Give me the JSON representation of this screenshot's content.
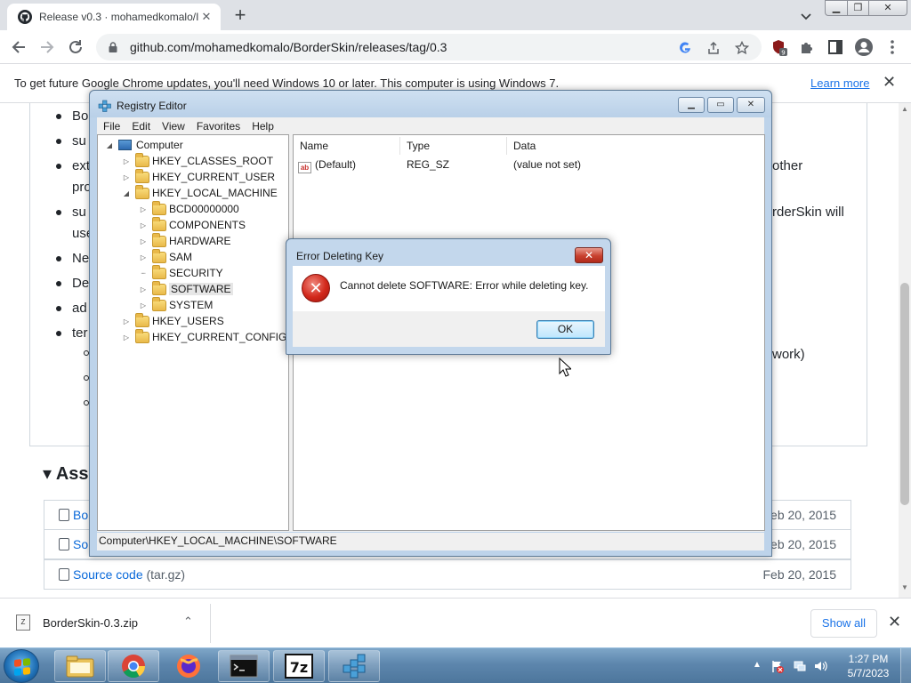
{
  "browser": {
    "tab_title": "Release v0.3 · mohamedkomalo/I",
    "new_tab": "+",
    "url": "github.com/mohamedkomalo/BorderSkin/releases/tag/0.3",
    "extension_badge": "9"
  },
  "infobar": {
    "message": "To get future Google Chrome updates, you'll need Windows 10 or later. This computer is using Windows 7.",
    "link": "Learn more"
  },
  "page": {
    "bullets": [
      "Bo",
      "su",
      "ext",
      "pro",
      "su",
      "use",
      "Ne",
      "De",
      "ad",
      "ter"
    ],
    "right_fragments": [
      "other",
      "rderSkin will",
      "work)"
    ],
    "assets_title": "Asse",
    "assets": [
      {
        "name": "Bo",
        "ext": "",
        "date": "Feb 20, 2015"
      },
      {
        "name": "Sou",
        "ext": "",
        "date": "Feb 20, 2015"
      },
      {
        "name": "Source code",
        "ext": "(tar.gz)",
        "date": "Feb 20, 2015"
      }
    ]
  },
  "downloads": {
    "file": "BorderSkin-0.3.zip",
    "show_all": "Show all"
  },
  "taskbar": {
    "time": "1:27 PM",
    "date": "5/7/2023"
  },
  "regedit": {
    "title": "Registry Editor",
    "menu": [
      "File",
      "Edit",
      "View",
      "Favorites",
      "Help"
    ],
    "tree": {
      "root": "Computer",
      "hives": [
        "HKEY_CLASSES_ROOT",
        "HKEY_CURRENT_USER",
        "HKEY_LOCAL_MACHINE"
      ],
      "hklm_children": [
        "BCD00000000",
        "COMPONENTS",
        "HARDWARE",
        "SAM",
        "SECURITY",
        "SOFTWARE",
        "SYSTEM"
      ],
      "other_hives": [
        "HKEY_USERS",
        "HKEY_CURRENT_CONFIG"
      ],
      "selected": "SOFTWARE"
    },
    "columns": {
      "name": "Name",
      "type": "Type",
      "data": "Data"
    },
    "values": [
      {
        "name": "(Default)",
        "type": "REG_SZ",
        "data": "(value not set)"
      }
    ],
    "status": "Computer\\HKEY_LOCAL_MACHINE\\SOFTWARE"
  },
  "dialog": {
    "title": "Error Deleting Key",
    "message": "Cannot delete SOFTWARE:  Error while deleting key.",
    "ok": "OK"
  },
  "colors": {
    "link": "#1a73e8",
    "github_link": "#0969da",
    "selection": "#e6e6e6",
    "error_red": "#d2281b"
  }
}
